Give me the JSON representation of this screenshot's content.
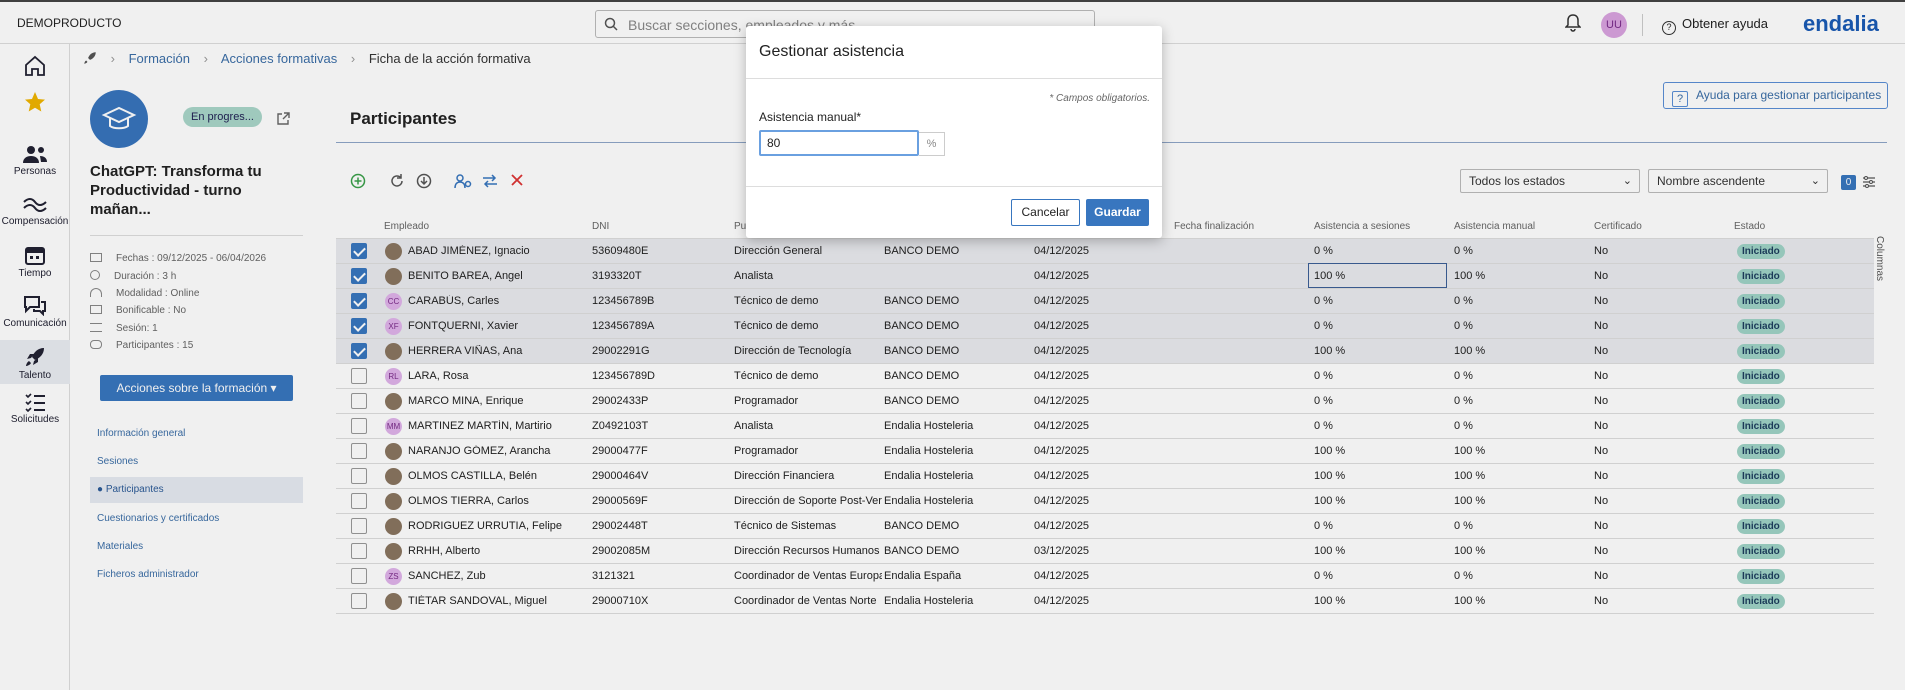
{
  "app": {
    "brand": "DEMOPRODUCTO",
    "search_placeholder": "Buscar secciones, empleados y más",
    "user_initials": "UU",
    "help_label": "Obtener ayuda",
    "logo": "endalia"
  },
  "nav": [
    {
      "label": "",
      "icon": "home-icon"
    },
    {
      "label": "",
      "icon": "star-icon"
    },
    {
      "label": "Personas",
      "icon": "people-icon"
    },
    {
      "label": "Compensación",
      "icon": "compensation-icon"
    },
    {
      "label": "Tiempo",
      "icon": "calendar-icon"
    },
    {
      "label": "Comunicación",
      "icon": "chat-icon"
    },
    {
      "label": "Talento",
      "icon": "rocket-icon"
    },
    {
      "label": "Solicitudes",
      "icon": "list-icon"
    }
  ],
  "breadcrumb": {
    "l1": "Formación",
    "l2": "Acciones formativas",
    "l3": "Ficha de la acción formativa"
  },
  "course": {
    "status": "En progres...",
    "title": "ChatGPT: Transforma tu Productividad - turno mañan...",
    "meta": [
      "Fechas : 09/12/2025 - 06/04/2026",
      "Duración : 3 h",
      "Modalidad : Online",
      "Bonificable : No",
      "Sesión: 1",
      "Participantes : 15"
    ],
    "actions_button": "Acciones sobre la formación ▾",
    "links": [
      "Información general",
      "Sesiones",
      "● Participantes",
      "Cuestionarios y certificados",
      "Materiales",
      "Ficheros administrador"
    ]
  },
  "main": {
    "title": "Participantes",
    "help_button": "Ayuda para gestionar participantes",
    "filter_state": "Todos los estados",
    "sort": "Nombre ascendente",
    "filter_count": "0",
    "columns_tab": "Columnas",
    "headers": [
      "Empleado",
      "DNI",
      "Pu",
      "",
      "",
      "Fecha finalización",
      "Asistencia a sesiones",
      "Asistencia manual",
      "Certificado",
      "Estado"
    ]
  },
  "rows": [
    {
      "sel": true,
      "name": "ABAD JIMÉNEZ, Ignacio",
      "init": "",
      "dni": "53609480E",
      "puesto": "Dirección General",
      "empresa": "BANCO DEMO",
      "fecha": "04/12/2025",
      "asis": "0 %",
      "manual": "0 %",
      "cert": "No",
      "estado": "Iniciado"
    },
    {
      "sel": true,
      "name": "BENITO BAREA, Angel",
      "init": "",
      "dni": "3193320T",
      "puesto": "Analista",
      "empresa": "",
      "fecha": "04/12/2025",
      "asis": "100 %",
      "manual": "100 %",
      "cert": "No",
      "estado": "Iniciado"
    },
    {
      "sel": true,
      "name": "CARABÚS, Carles",
      "init": "CC",
      "dni": "123456789B",
      "puesto": "Técnico de demo",
      "empresa": "BANCO DEMO",
      "fecha": "04/12/2025",
      "asis": "0 %",
      "manual": "0 %",
      "cert": "No",
      "estado": "Iniciado"
    },
    {
      "sel": true,
      "name": "FONTQUERNI, Xavier",
      "init": "XF",
      "dni": "123456789A",
      "puesto": "Técnico de demo",
      "empresa": "BANCO DEMO",
      "fecha": "04/12/2025",
      "asis": "0 %",
      "manual": "0 %",
      "cert": "No",
      "estado": "Iniciado"
    },
    {
      "sel": true,
      "name": "HERRERA VIÑAS, Ana",
      "init": "",
      "dni": "29002291G",
      "puesto": "Dirección de Tecnología",
      "empresa": "BANCO DEMO",
      "fecha": "04/12/2025",
      "asis": "100 %",
      "manual": "100 %",
      "cert": "No",
      "estado": "Iniciado"
    },
    {
      "sel": false,
      "name": "LARA, Rosa",
      "init": "RL",
      "dni": "123456789D",
      "puesto": "Técnico de demo",
      "empresa": "BANCO DEMO",
      "fecha": "04/12/2025",
      "asis": "0 %",
      "manual": "0 %",
      "cert": "No",
      "estado": "Iniciado"
    },
    {
      "sel": false,
      "name": "MARCO MINA, Enrique",
      "init": "",
      "dni": "29002433P",
      "puesto": "Programador",
      "empresa": "BANCO DEMO",
      "fecha": "04/12/2025",
      "asis": "0 %",
      "manual": "0 %",
      "cert": "No",
      "estado": "Iniciado"
    },
    {
      "sel": false,
      "name": "MARTINEZ MARTÍN, Martirio",
      "init": "MM",
      "dni": "Z0492103T",
      "puesto": "Analista",
      "empresa": "Endalia Hosteleria",
      "fecha": "04/12/2025",
      "asis": "0 %",
      "manual": "0 %",
      "cert": "No",
      "estado": "Iniciado"
    },
    {
      "sel": false,
      "name": "NARANJO GÓMEZ, Arancha",
      "init": "",
      "dni": "29000477F",
      "puesto": "Programador",
      "empresa": "Endalia Hosteleria",
      "fecha": "04/12/2025",
      "asis": "100 %",
      "manual": "100 %",
      "cert": "No",
      "estado": "Iniciado"
    },
    {
      "sel": false,
      "name": "OLMOS CASTILLA, Belén",
      "init": "",
      "dni": "29000464V",
      "puesto": "Dirección Financiera",
      "empresa": "Endalia Hosteleria",
      "fecha": "04/12/2025",
      "asis": "100 %",
      "manual": "100 %",
      "cert": "No",
      "estado": "Iniciado"
    },
    {
      "sel": false,
      "name": "OLMOS TIERRA, Carlos",
      "init": "",
      "dni": "29000569F",
      "puesto": "Dirección de Soporte Post-Ver",
      "empresa": "Endalia Hosteleria",
      "fecha": "04/12/2025",
      "asis": "100 %",
      "manual": "100 %",
      "cert": "No",
      "estado": "Iniciado"
    },
    {
      "sel": false,
      "name": "RODRIGUEZ URRUTIA, Felipe",
      "init": "",
      "dni": "29002448T",
      "puesto": "Técnico de Sistemas",
      "empresa": "BANCO DEMO",
      "fecha": "04/12/2025",
      "asis": "0 %",
      "manual": "0 %",
      "cert": "No",
      "estado": "Iniciado"
    },
    {
      "sel": false,
      "name": "RRHH, Alberto",
      "init": "",
      "dni": "29002085M",
      "puesto": "Dirección Recursos Humanos",
      "empresa": "BANCO DEMO",
      "fecha": "03/12/2025",
      "asis": "100 %",
      "manual": "100 %",
      "cert": "No",
      "estado": "Iniciado"
    },
    {
      "sel": false,
      "name": "SANCHEZ, Zub",
      "init": "ZS",
      "dni": "3121321",
      "puesto": "Coordinador de Ventas Europa",
      "empresa": "Endalia España",
      "fecha": "04/12/2025",
      "asis": "0 %",
      "manual": "0 %",
      "cert": "No",
      "estado": "Iniciado"
    },
    {
      "sel": false,
      "name": "TIÉTAR SANDOVAL, Miguel",
      "init": "",
      "dni": "29000710X",
      "puesto": "Coordinador de Ventas Norte",
      "empresa": "Endalia Hosteleria",
      "fecha": "04/12/2025",
      "asis": "100 %",
      "manual": "100 %",
      "cert": "No",
      "estado": "Iniciado"
    }
  ],
  "modal": {
    "title": "Gestionar asistencia",
    "required_note": "* Campos obligatorios.",
    "field_label": "Asistencia manual*",
    "field_value": "80",
    "unit": "%",
    "cancel": "Cancelar",
    "save": "Guardar"
  }
}
